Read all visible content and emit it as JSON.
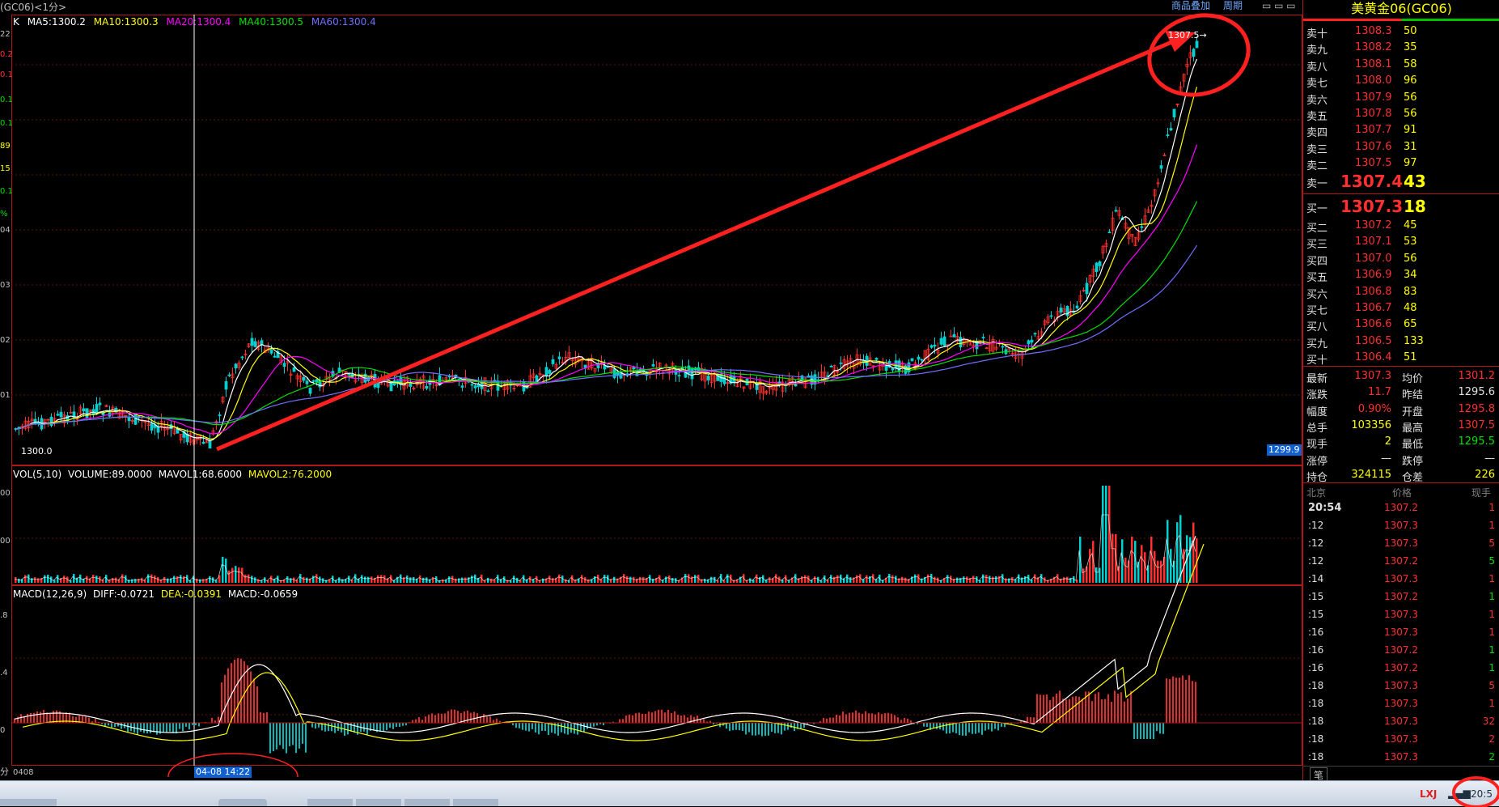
{
  "window": {
    "title_fragment": "(GC06)<1分>",
    "top_links": [
      "商品叠加",
      "周期"
    ]
  },
  "main_panel": {
    "ma_legend": [
      {
        "text": "K",
        "color": "#ffffff"
      },
      {
        "text": "MA5:1300.2",
        "color": "#ffffff"
      },
      {
        "text": "MA10:1300.3",
        "color": "#ffff00"
      },
      {
        "text": "MA20:1300.4",
        "color": "#ff00ff"
      },
      {
        "text": "MA40:1300.5",
        "color": "#00e000"
      },
      {
        "text": "MA60:1300.4",
        "color": "#7070ff"
      }
    ],
    "left_axis_labels": [
      "22",
      "0.2",
      "0.1",
      "0.1",
      "0.1",
      "89",
      "15",
      "0.1",
      "%",
      "04",
      "03",
      "02",
      "01"
    ],
    "cursor_price_label": "1300.0",
    "right_edge_price_label": "1299.9",
    "peak_label": "1307.5→"
  },
  "volume_panel": {
    "legend": [
      {
        "text": "VOL(5,10)",
        "color": "#ffffff"
      },
      {
        "text": "VOLUME:89.0000",
        "color": "#ffffff"
      },
      {
        "text": "MAVOL1:68.6000",
        "color": "#ffffff"
      },
      {
        "text": "MAVOL2:76.2000",
        "color": "#ffff00"
      }
    ],
    "axis_labels": [
      "00",
      "00"
    ]
  },
  "macd_panel": {
    "legend": [
      {
        "text": "MACD(12,26,9)",
        "color": "#ffffff"
      },
      {
        "text": "DIFF:-0.0721",
        "color": "#ffffff"
      },
      {
        "text": "DEA:-0.0391",
        "color": "#ffff00"
      },
      {
        "text": "MACD:-0.0659",
        "color": "#ffffff"
      }
    ],
    "axis_labels": [
      ".8",
      ".4",
      "0"
    ]
  },
  "time_axis": {
    "left_label": "分",
    "date_label": "0408",
    "cursor_time": "04-08 14:22"
  },
  "quote_panel": {
    "title": "美黄金06(GC06)",
    "asks": [
      {
        "label": "卖十",
        "price": "1308.3",
        "vol": "50"
      },
      {
        "label": "卖九",
        "price": "1308.2",
        "vol": "35"
      },
      {
        "label": "卖八",
        "price": "1308.1",
        "vol": "58"
      },
      {
        "label": "卖七",
        "price": "1308.0",
        "vol": "96"
      },
      {
        "label": "卖六",
        "price": "1307.9",
        "vol": "56"
      },
      {
        "label": "卖五",
        "price": "1307.8",
        "vol": "56"
      },
      {
        "label": "卖四",
        "price": "1307.7",
        "vol": "91"
      },
      {
        "label": "卖三",
        "price": "1307.6",
        "vol": "31"
      },
      {
        "label": "卖二",
        "price": "1307.5",
        "vol": "97"
      }
    ],
    "ask1": {
      "label": "卖一",
      "price": "1307.4",
      "vol": "43"
    },
    "bid1": {
      "label": "买一",
      "price": "1307.3",
      "vol": "18"
    },
    "bids": [
      {
        "label": "买二",
        "price": "1307.2",
        "vol": "45"
      },
      {
        "label": "买三",
        "price": "1307.1",
        "vol": "53"
      },
      {
        "label": "买四",
        "price": "1307.0",
        "vol": "56"
      },
      {
        "label": "买五",
        "price": "1306.9",
        "vol": "34"
      },
      {
        "label": "买六",
        "price": "1306.8",
        "vol": "83"
      },
      {
        "label": "买七",
        "price": "1306.7",
        "vol": "48"
      },
      {
        "label": "买八",
        "price": "1306.6",
        "vol": "65"
      },
      {
        "label": "买九",
        "price": "1306.5",
        "vol": "133"
      },
      {
        "label": "买十",
        "price": "1306.4",
        "vol": "51"
      }
    ],
    "stats": [
      {
        "l1": "最新",
        "v1": "1307.3",
        "c1": "#ff3030",
        "l2": "均价",
        "v2": "1301.2",
        "c2": "#ff3030"
      },
      {
        "l1": "涨跌",
        "v1": "11.7",
        "c1": "#ff3030",
        "l2": "昨结",
        "v2": "1295.6",
        "c2": "#e0e0e0"
      },
      {
        "l1": "幅度",
        "v1": "0.90%",
        "c1": "#ff3030",
        "l2": "开盘",
        "v2": "1295.8",
        "c2": "#ff3030"
      },
      {
        "l1": "总手",
        "v1": "103356",
        "c1": "#ffff00",
        "l2": "最高",
        "v2": "1307.5",
        "c2": "#ff3030"
      },
      {
        "l1": "现手",
        "v1": "2",
        "c1": "#ffff00",
        "l2": "最低",
        "v2": "1295.5",
        "c2": "#00e000"
      },
      {
        "l1": "涨停",
        "v1": "—",
        "c1": "#e0e0e0",
        "l2": "跌停",
        "v2": "—",
        "c2": "#e0e0e0"
      },
      {
        "l1": "持仓",
        "v1": "324115",
        "c1": "#ffff00",
        "l2": "仓差",
        "v2": "226",
        "c2": "#ffff00"
      }
    ],
    "ticks_header": {
      "c1": "北京",
      "c2": "价格",
      "c3": "现手"
    },
    "ticks": [
      {
        "t": "20:54",
        "p": "1307.2",
        "v": "1",
        "vc": "#ff3030"
      },
      {
        "t": ":12",
        "p": "1307.3",
        "v": "1",
        "vc": "#ff3030"
      },
      {
        "t": ":12",
        "p": "1307.3",
        "v": "5",
        "vc": "#ff3030"
      },
      {
        "t": ":12",
        "p": "1307.2",
        "v": "5",
        "vc": "#00e000"
      },
      {
        "t": ":14",
        "p": "1307.3",
        "v": "1",
        "vc": "#ff3030"
      },
      {
        "t": ":15",
        "p": "1307.2",
        "v": "1",
        "vc": "#00e000"
      },
      {
        "t": ":15",
        "p": "1307.3",
        "v": "1",
        "vc": "#ff3030"
      },
      {
        "t": ":16",
        "p": "1307.3",
        "v": "1",
        "vc": "#ff3030"
      },
      {
        "t": ":16",
        "p": "1307.2",
        "v": "1",
        "vc": "#00e000"
      },
      {
        "t": ":16",
        "p": "1307.2",
        "v": "1",
        "vc": "#00e000"
      },
      {
        "t": ":18",
        "p": "1307.3",
        "v": "5",
        "vc": "#ff3030"
      },
      {
        "t": ":18",
        "p": "1307.3",
        "v": "1",
        "vc": "#ff3030"
      },
      {
        "t": ":18",
        "p": "1307.3",
        "v": "32",
        "vc": "#ff3030"
      },
      {
        "t": ":18",
        "p": "1307.3",
        "v": "2",
        "vc": "#ff3030"
      },
      {
        "t": ":18",
        "p": "1307.3",
        "v": "2",
        "vc": "#00e000"
      }
    ],
    "bottom_tab": "笔"
  },
  "taskbar": {
    "tray_text": "LXJ",
    "clock": "20:5"
  },
  "chart_data": {
    "type": "candlestick",
    "title": "美黄金06(GC06) 1分",
    "y_range": [
      1299.9,
      1307.5
    ],
    "start": 1300.2,
    "peak": 1307.5,
    "last": 1307.3,
    "annotations": [
      "red arrow from 04-08 14:22 low to the 1307.5 peak",
      "red circle around peak"
    ]
  }
}
